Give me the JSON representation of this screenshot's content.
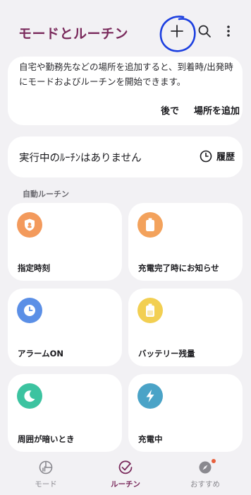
{
  "header": {
    "title": "モードとルーチン"
  },
  "info_card": {
    "text": "自宅や勤務先などの場所を追加すると、到着時/出発時にモードおよびルーチンを開始できます。",
    "later_label": "後で",
    "add_place_label": "場所を追加"
  },
  "status_card": {
    "text": "実行中のﾙｰﾁﾝはありません",
    "history_label": "履歴"
  },
  "section": {
    "label": "自動ルーチン"
  },
  "tiles": [
    {
      "label": "指定時刻",
      "icon": "timer-lock-icon",
      "color": "#f39a5c"
    },
    {
      "label": "充電完了時にお知らせ",
      "icon": "battery-full-icon",
      "color": "#f3a25c"
    },
    {
      "label": "アラームON",
      "icon": "alarm-clock-icon",
      "color": "#5b8fe6"
    },
    {
      "label": "バッテリー残量",
      "icon": "battery-icon",
      "color": "#f2cf52"
    },
    {
      "label": "周囲が暗いとき",
      "icon": "moon-icon",
      "color": "#3cc3a0"
    },
    {
      "label": "充電中",
      "icon": "lightning-icon",
      "color": "#4aa3c7"
    }
  ],
  "nav": {
    "items": [
      {
        "label": "モード",
        "icon": "mode-icon"
      },
      {
        "label": "ルーチン",
        "icon": "routine-check-icon",
        "active": true
      },
      {
        "label": "おすすめ",
        "icon": "compass-icon",
        "badge": true
      }
    ]
  },
  "colors": {
    "accent": "#7a2a5c",
    "annotation": "#1c3fe0",
    "badge": "#e8603c"
  }
}
